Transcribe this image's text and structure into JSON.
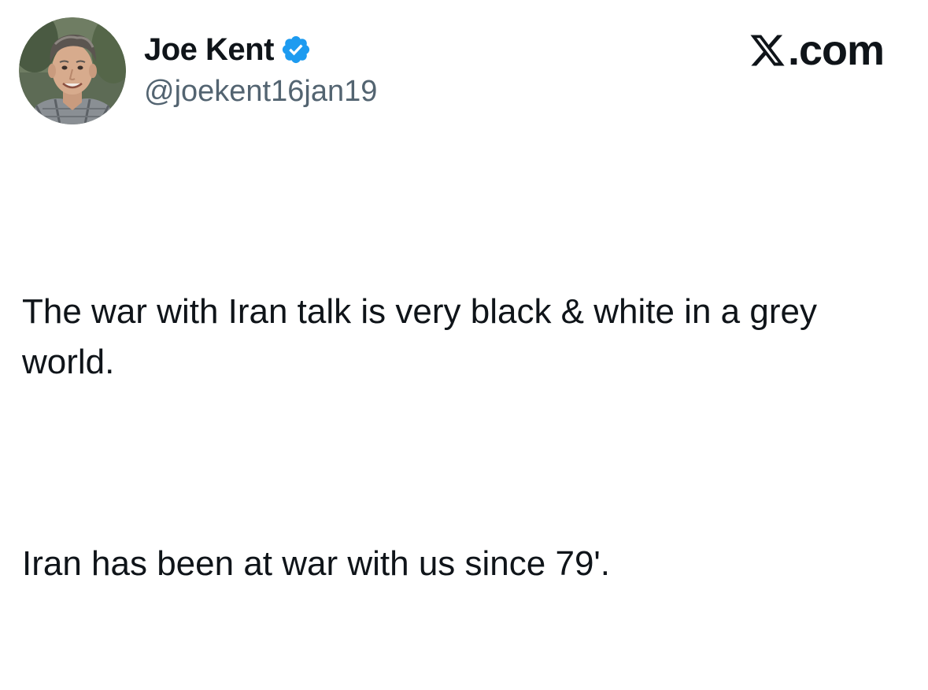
{
  "author": {
    "display_name": "Joe Kent",
    "handle": "@joekent16jan19",
    "verified_icon": "verified-badge-icon",
    "avatar_icon": "profile-photo"
  },
  "brand": {
    "logo_icon": "x-logo-icon",
    "suffix": ".com"
  },
  "tweet": {
    "paragraphs": [
      "The war with Iran talk is very black & white in a grey world.",
      "Iran has been at war with us since 79'."
    ]
  },
  "colors": {
    "text": "#0f1419",
    "secondary_text": "#536471",
    "verified_blue": "#1d9bf0",
    "background": "#ffffff"
  }
}
